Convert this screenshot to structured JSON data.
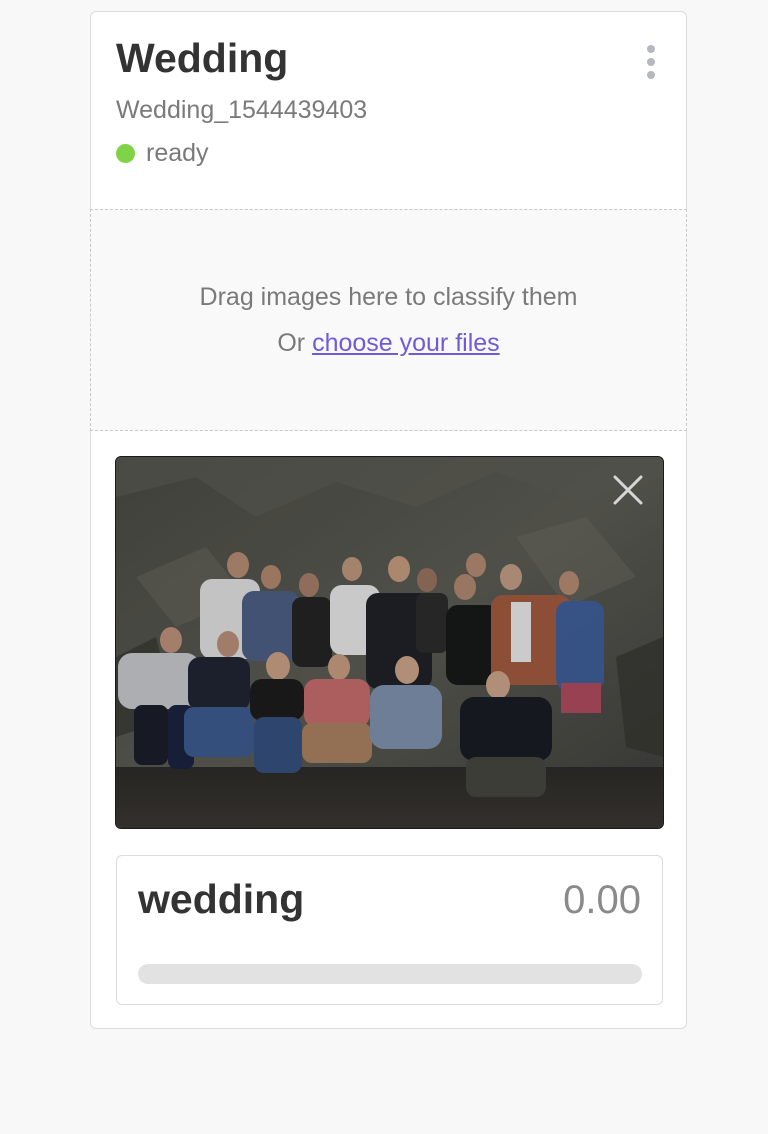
{
  "card": {
    "title": "Wedding",
    "subtitle": "Wedding_1544439403",
    "status": "ready",
    "status_color": "#7ed347",
    "menu_icon": "more-vertical-icon"
  },
  "dropzone": {
    "text": "Drag images here to classify them",
    "or_text": "Or",
    "choose_link": "choose your files"
  },
  "image": {
    "close_icon": "close-icon"
  },
  "result": {
    "label": "wedding",
    "score": "0.00",
    "progress_fraction": 0.0
  }
}
